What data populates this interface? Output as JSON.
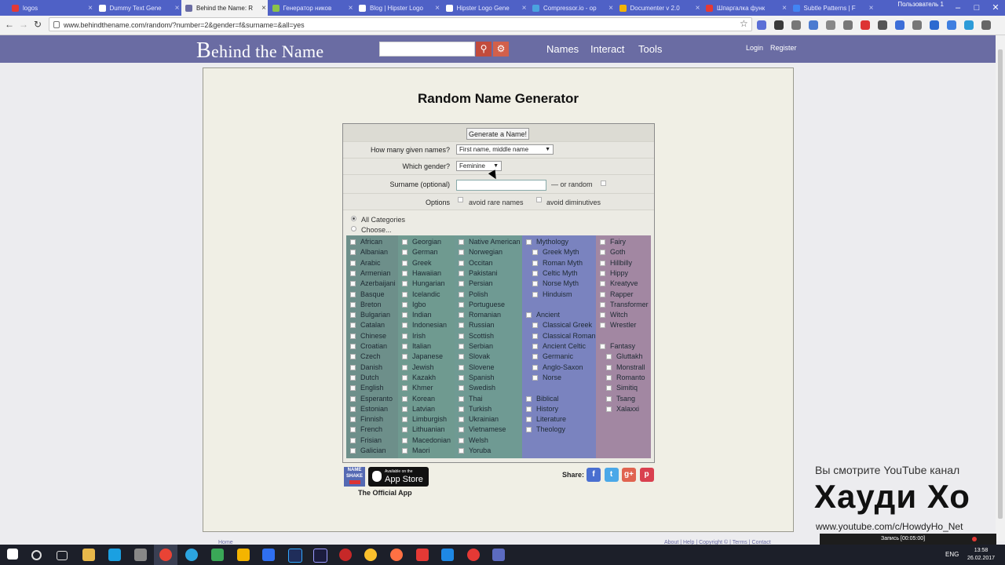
{
  "browser": {
    "tabs": [
      {
        "label": "logos",
        "color": "#e53935",
        "active": false
      },
      {
        "label": "Dummy Text Gene",
        "color": "#ffffff",
        "active": false
      },
      {
        "label": "Behind the Name: R",
        "color": "#6a6ca3",
        "active": true
      },
      {
        "label": "Генератор ников",
        "color": "#8bc34a",
        "active": false
      },
      {
        "label": "Blog | Hipster Logo",
        "color": "#ffffff",
        "active": false
      },
      {
        "label": "Hipster Logo Gene",
        "color": "#ffffff",
        "active": false
      },
      {
        "label": "Compressor.io - op",
        "color": "#4aa3df",
        "active": false
      },
      {
        "label": "Documenter v 2.0",
        "color": "#f4b400",
        "active": false
      },
      {
        "label": "Шпаргалка функ",
        "color": "#e53935",
        "active": false
      },
      {
        "label": "Subtle Patterns | F",
        "color": "#4285f4",
        "active": false
      }
    ],
    "profile": "Пользователь 1",
    "url": "www.behindthename.com/random/?number=2&gender=f&surname=&all=yes"
  },
  "site": {
    "logo_initial": "B",
    "logo_rest": "ehind the Name",
    "nav": [
      "Names",
      "Interact",
      "Tools"
    ],
    "login": "Login",
    "register": "Register"
  },
  "generator": {
    "title": "Random Name Generator",
    "generate_button": "Generate a Name!",
    "given_names_label": "How many given names?",
    "given_names_value": "First name, middle name",
    "gender_label": "Which gender?",
    "gender_value": "Feminine",
    "surname_label": "Surname (optional)",
    "surname_value": "",
    "or_random": "— or random",
    "options_label": "Options",
    "avoid_rare": "avoid rare names",
    "avoid_diminutives": "avoid diminutives",
    "all_categories": "All Categories",
    "choose": "Choose...",
    "columns": [
      {
        "color": "#6d8f8a",
        "items": [
          "African",
          "Albanian",
          "Arabic",
          "Armenian",
          "Azerbaijani",
          "Basque",
          "Breton",
          "Bulgarian",
          "Catalan",
          "Chinese",
          "Croatian",
          "Czech",
          "Danish",
          "Dutch",
          "English",
          "Esperanto",
          "Estonian",
          "Finnish",
          "French",
          "Frisian",
          "Galician"
        ]
      },
      {
        "color": "#6f9a90",
        "items": [
          "Georgian",
          "German",
          "Greek",
          "Hawaiian",
          "Hungarian",
          "Icelandic",
          "Igbo",
          "Indian",
          "Indonesian",
          "Irish",
          "Italian",
          "Japanese",
          "Jewish",
          "Kazakh",
          "Khmer",
          "Korean",
          "Latvian",
          "Limburgish",
          "Lithuanian",
          "Macedonian",
          "Maori"
        ]
      },
      {
        "color": "#6f9a93",
        "items": [
          "Native American",
          "Norwegian",
          "Occitan",
          "Pakistani",
          "Persian",
          "Polish",
          "Portuguese",
          "Romanian",
          "Russian",
          "Scottish",
          "Serbian",
          "Slovak",
          "Slovene",
          "Spanish",
          "Swedish",
          "Thai",
          "Turkish",
          "Ukrainian",
          "Vietnamese",
          "Welsh",
          "Yoruba"
        ]
      },
      {
        "color": "#7a83bf",
        "groups": [
          {
            "items": [
              {
                "text": "Mythology",
                "indent": 0
              },
              {
                "text": "Greek Myth",
                "indent": 1
              },
              {
                "text": "Roman Myth",
                "indent": 1
              },
              {
                "text": "Celtic Myth",
                "indent": 1
              },
              {
                "text": "Norse Myth",
                "indent": 1
              },
              {
                "text": "Hinduism",
                "indent": 1
              }
            ]
          },
          {
            "items": [
              {
                "text": "Ancient",
                "indent": 0
              },
              {
                "text": "Classical Greek",
                "indent": 1
              },
              {
                "text": "Classical Roman",
                "indent": 1
              },
              {
                "text": "Ancient Celtic",
                "indent": 1
              },
              {
                "text": "Germanic",
                "indent": 1
              },
              {
                "text": "Anglo-Saxon",
                "indent": 1
              },
              {
                "text": "Norse",
                "indent": 1
              }
            ]
          },
          {
            "items": [
              {
                "text": "Biblical",
                "indent": 0
              },
              {
                "text": "History",
                "indent": 0
              },
              {
                "text": "Literature",
                "indent": 0
              },
              {
                "text": "Theology",
                "indent": 0
              }
            ]
          }
        ]
      },
      {
        "color": "#a287a2",
        "groups": [
          {
            "items": [
              {
                "text": "Fairy",
                "indent": 0
              },
              {
                "text": "Goth",
                "indent": 0
              },
              {
                "text": "Hillbilly",
                "indent": 0
              },
              {
                "text": "Hippy",
                "indent": 0
              },
              {
                "text": "Kreatyve",
                "indent": 0
              },
              {
                "text": "Rapper",
                "indent": 0
              },
              {
                "text": "Transformer",
                "indent": 0
              },
              {
                "text": "Witch",
                "indent": 0
              },
              {
                "text": "Wrestler",
                "indent": 0
              }
            ]
          },
          {
            "items": [
              {
                "text": "Fantasy",
                "indent": 0
              },
              {
                "text": "Gluttakh",
                "indent": 1
              },
              {
                "text": "Monstrall",
                "indent": 1
              },
              {
                "text": "Romanto",
                "indent": 1
              },
              {
                "text": "Simitiq",
                "indent": 1
              },
              {
                "text": "Tsang",
                "indent": 1
              },
              {
                "text": "Xalaxxi",
                "indent": 1
              }
            ]
          }
        ]
      }
    ],
    "app_badge_small": "Available on the",
    "app_badge_big": "App Store",
    "nameshake": "NAME SHAKE",
    "official_app": "The Official App",
    "share_label": "Share:",
    "share_icons": [
      {
        "name": "facebook-icon",
        "glyph": "f",
        "color": "#4a6fd0"
      },
      {
        "name": "twitter-icon",
        "glyph": "t",
        "color": "#4aa8e8"
      },
      {
        "name": "google-plus-icon",
        "glyph": "g+",
        "color": "#e0634f"
      },
      {
        "name": "pinterest-icon",
        "glyph": "p",
        "color": "#d9404f"
      }
    ]
  },
  "footer": {
    "home": "Home",
    "links": "About | Help | Copyright © | Terms | Contact"
  },
  "watermark": {
    "line1": "Вы смотрите YouTube канал",
    "line2": "Хауди Хо",
    "line3": "www.youtube.com/c/HowdyHo_Net"
  },
  "recorder": {
    "label": "Запись [00:05:00]"
  },
  "taskbar": {
    "lang": "ENG",
    "time": "13:58",
    "date": "26.02.2017"
  }
}
